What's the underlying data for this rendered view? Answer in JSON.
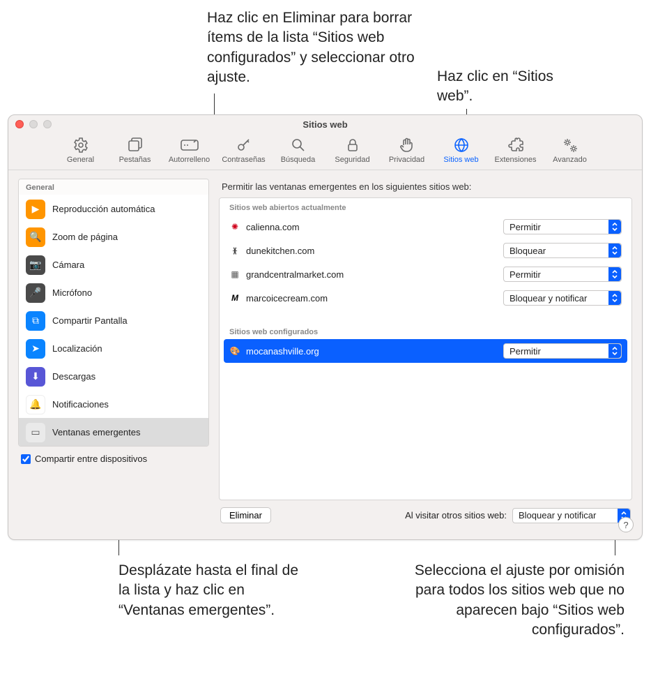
{
  "callouts": {
    "top_left": "Haz clic en Eliminar para borrar ítems de la lista “Sitios web configurados” y seleccionar otro ajuste.",
    "top_right": "Haz clic en “Sitios web”.",
    "bottom_left": "Desplázate hasta el final de la lista y haz clic en “Ventanas emergentes”.",
    "bottom_right": "Selecciona el ajuste por omisión para todos los sitios web que no aparecen bajo “Sitios web configurados”."
  },
  "window": {
    "title": "Sitios web"
  },
  "toolbar": {
    "general": "General",
    "tabs": "Pestañas",
    "autofill": "Autorrelleno",
    "passwords": "Contraseñas",
    "search": "Búsqueda",
    "security": "Seguridad",
    "privacy": "Privacidad",
    "websites": "Sitios web",
    "extensions": "Extensiones",
    "advanced": "Avanzado"
  },
  "sidebar": {
    "head": "General",
    "items": [
      "Reproducción automática",
      "Zoom de página",
      "Cámara",
      "Micrófono",
      "Compartir Pantalla",
      "Localización",
      "Descargas",
      "Notificaciones",
      "Ventanas emergentes"
    ],
    "share_label": "Compartir entre dispositivos"
  },
  "main": {
    "heading": "Permitir las ventanas emergentes en los siguientes sitios web:",
    "open_head": "Sitios web abiertos actualmente",
    "open_rows": [
      {
        "site": "calienna.com",
        "setting": "Permitir"
      },
      {
        "site": "dunekitchen.com",
        "setting": "Bloquear"
      },
      {
        "site": "grandcentralmarket.com",
        "setting": "Permitir"
      },
      {
        "site": "marcoicecream.com",
        "setting": "Bloquear y notificar"
      }
    ],
    "conf_head": "Sitios web configurados",
    "conf_rows": [
      {
        "site": "mocanashville.org",
        "setting": "Permitir"
      }
    ],
    "remove_label": "Eliminar",
    "others_label": "Al visitar otros sitios web:",
    "others_value": "Bloquear y notificar"
  },
  "help": "?"
}
